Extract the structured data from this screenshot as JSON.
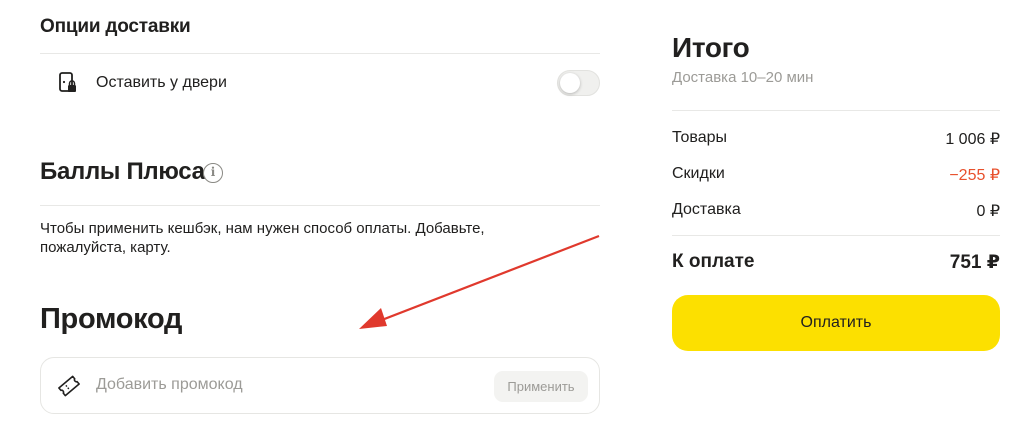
{
  "delivery_options": {
    "title": "Опции доставки",
    "leave_at_door": {
      "label": "Оставить у двери",
      "enabled": false,
      "icon": "door-lock-icon"
    }
  },
  "plus_points": {
    "title": "Баллы Плюса",
    "info_icon": "info-icon",
    "info_glyph": "i",
    "message": "Чтобы применить кешбэк, нам нужен способ оплаты. Добавьте, пожалуйста, карту."
  },
  "promo": {
    "title": "Промокод",
    "placeholder": "Добавить промокод",
    "value": "",
    "apply_label": "Применить",
    "icon": "ticket-icon"
  },
  "summary": {
    "title": "Итого",
    "delivery_time": "Доставка 10–20 мин",
    "rows": [
      {
        "label": "Товары",
        "value": "1 006 ₽"
      },
      {
        "label": "Скидки",
        "value": "−255 ₽"
      },
      {
        "label": "Доставка",
        "value": "0 ₽"
      }
    ],
    "total_label": "К оплате",
    "total_value": "751 ₽",
    "pay_button": "Оплатить"
  },
  "colors": {
    "accent_button": "#fce000",
    "discount": "#e8502c",
    "annotation_arrow": "#e0392d"
  }
}
